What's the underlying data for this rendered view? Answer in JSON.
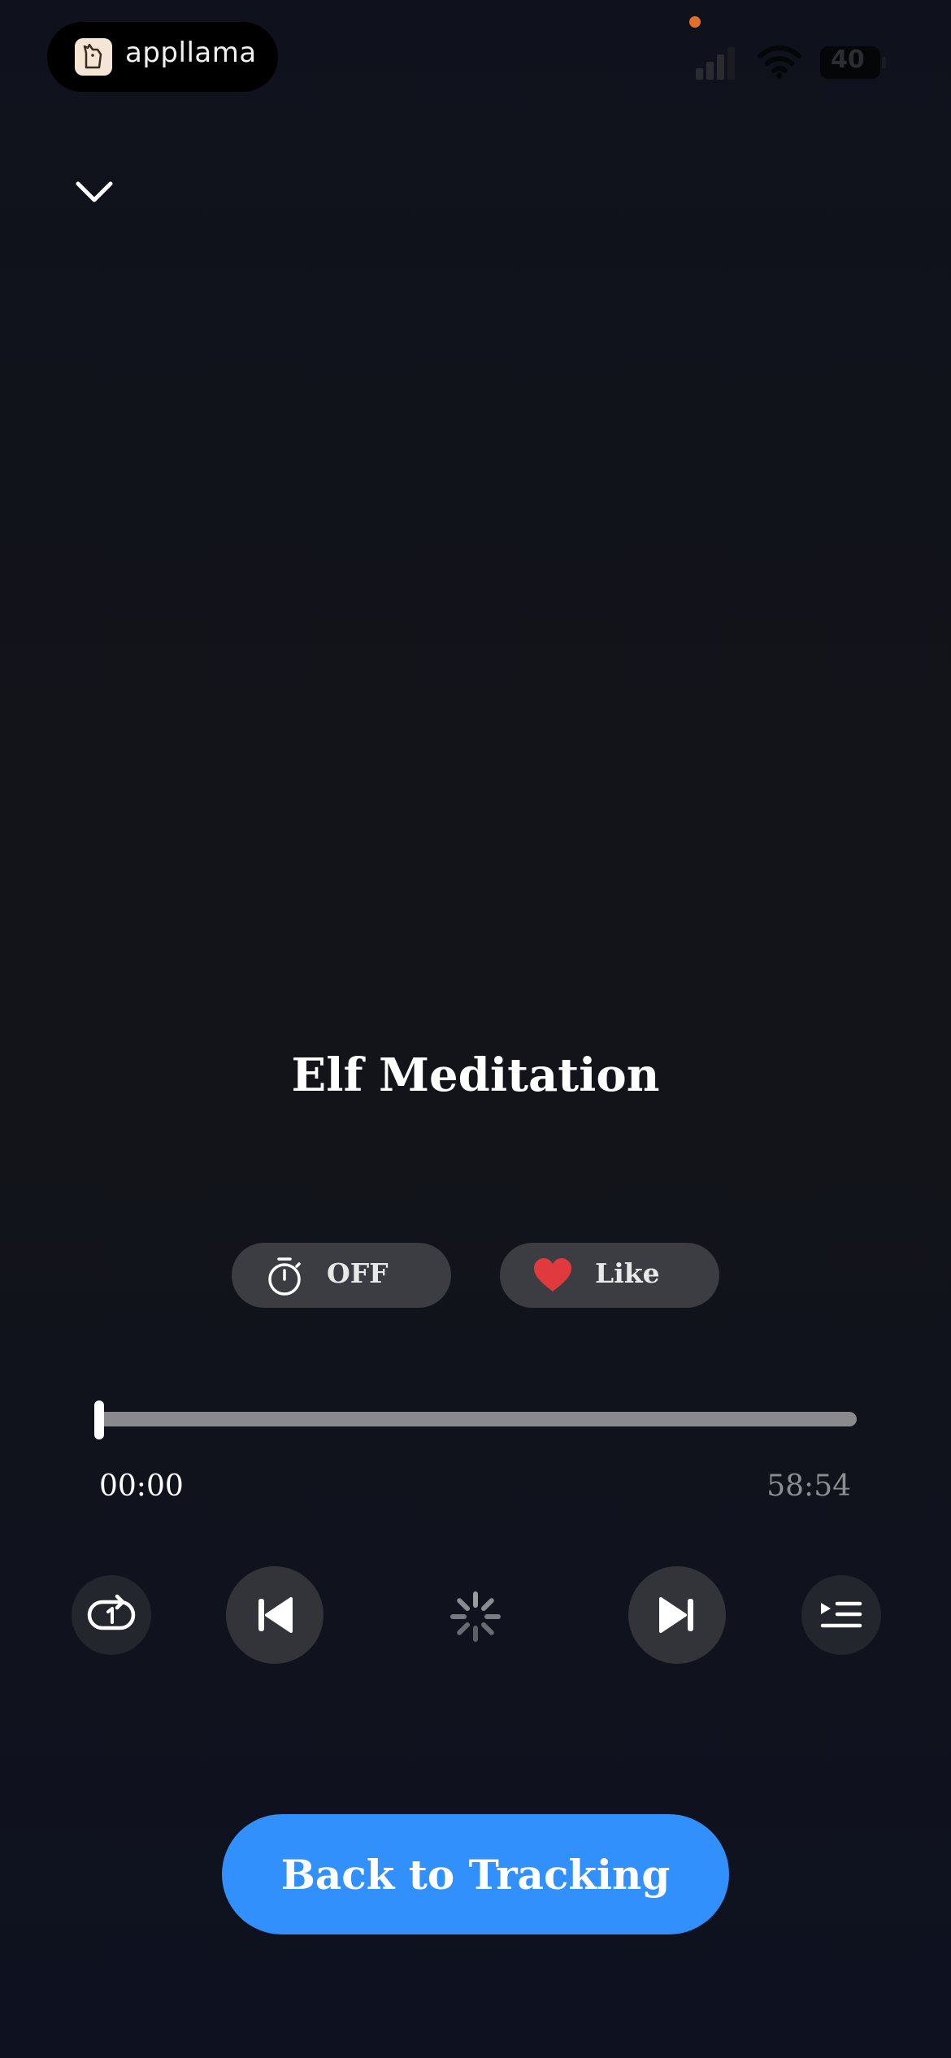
{
  "status_bar": {
    "app_name": "appllama",
    "battery": "40"
  },
  "player": {
    "title": "Elf Meditation",
    "sleep_timer_label": "OFF",
    "like_label": "Like",
    "progress": 0.0,
    "elapsed": "00:00",
    "duration": "58:54"
  },
  "actions": {
    "primary_cta": "Back to Tracking"
  },
  "colors": {
    "background": "#12141b",
    "accent": "#3290fd",
    "heart": "#e0393e",
    "chip": "#3b3d43"
  },
  "icons": {
    "collapse": "chevron-down-icon",
    "timer": "stopwatch-icon",
    "like": "heart-icon",
    "repeat": "repeat-one-icon",
    "previous": "skip-previous-icon",
    "loading": "spinner-icon",
    "next": "skip-next-icon",
    "queue": "queue-icon"
  }
}
